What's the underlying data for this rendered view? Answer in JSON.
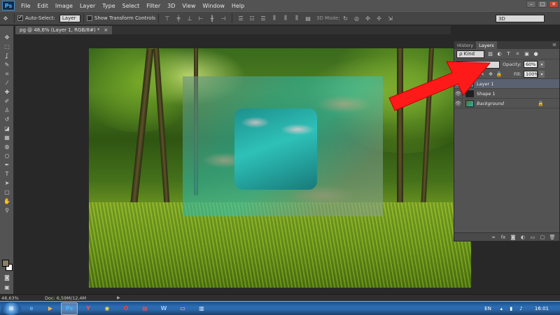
{
  "app": {
    "logo": "Ps"
  },
  "menu": [
    "File",
    "Edit",
    "Image",
    "Layer",
    "Type",
    "Select",
    "Filter",
    "3D",
    "View",
    "Window",
    "Help"
  ],
  "window_controls": [
    "–",
    "□",
    "✕"
  ],
  "options_bar": {
    "auto_select_label": "Auto-Select:",
    "auto_select_checked": true,
    "auto_select_target": "Layer",
    "transform_controls_label": "Show Transform Controls",
    "transform_controls_checked": false,
    "mode_3d_label": "3D Mode:",
    "workspace": "3D"
  },
  "document": {
    "tab_title": "pg @ 48,6% (Layer 1, RGB/8#) *",
    "close_glyph": "×"
  },
  "tools_icons": [
    "move-icon",
    "marquee-icon",
    "lasso-icon",
    "quick-select-icon",
    "crop-icon",
    "eyedropper-icon",
    "healing-icon",
    "brush-icon",
    "stamp-icon",
    "history-brush-icon",
    "eraser-icon",
    "gradient-icon",
    "blur-icon",
    "dodge-icon",
    "pen-icon",
    "type-icon",
    "path-select-icon",
    "shape-icon",
    "hand-icon",
    "zoom-icon"
  ],
  "tool_glyphs": [
    "✥",
    "⬚",
    "ʆ",
    "✎",
    "⌗",
    "⁄",
    "✚",
    "✐",
    "♙",
    "↺",
    "◪",
    "▦",
    "◍",
    "○",
    "✒",
    "T",
    "➤",
    "▢",
    "✋",
    "⚲"
  ],
  "colors": {
    "foreground": "#8a8065",
    "background": "#ffffff",
    "accent_arrow": "#ff1a1a"
  },
  "panel": {
    "tabs": [
      "History",
      "Layers"
    ],
    "active_tab": "Layers",
    "menu_glyph": "≡",
    "kind_label": "ρ Kind",
    "blend_mode": "",
    "opacity_label": "Opacity:",
    "opacity_value": "60%",
    "lock_label": "Lock:",
    "fill_label": "Fill:",
    "fill_value": "100%",
    "layers": [
      {
        "name": "Layer 1",
        "selected": true,
        "italic": false,
        "locked": false
      },
      {
        "name": "Shape 1",
        "selected": false,
        "italic": false,
        "locked": false
      },
      {
        "name": "Background",
        "selected": false,
        "italic": true,
        "locked": true
      }
    ],
    "footer_icons": [
      "link-icon",
      "fx-icon",
      "mask-icon",
      "adjustment-icon",
      "folder-icon",
      "new-layer-icon",
      "trash-icon"
    ]
  },
  "status": {
    "zoom": "48,63%",
    "doc": "Doc: 6,59M/12,4M",
    "arrow": "▶"
  },
  "taskbar": {
    "apps": [
      "ie-icon",
      "media-player-icon",
      "photoshop-icon",
      "yandex-icon",
      "chrome-icon",
      "opera-icon",
      "acrobat-icon",
      "word-icon",
      "explorer-icon",
      "notepad-icon"
    ],
    "active_app": "photoshop-icon",
    "language": "EN",
    "time": "16:01"
  }
}
